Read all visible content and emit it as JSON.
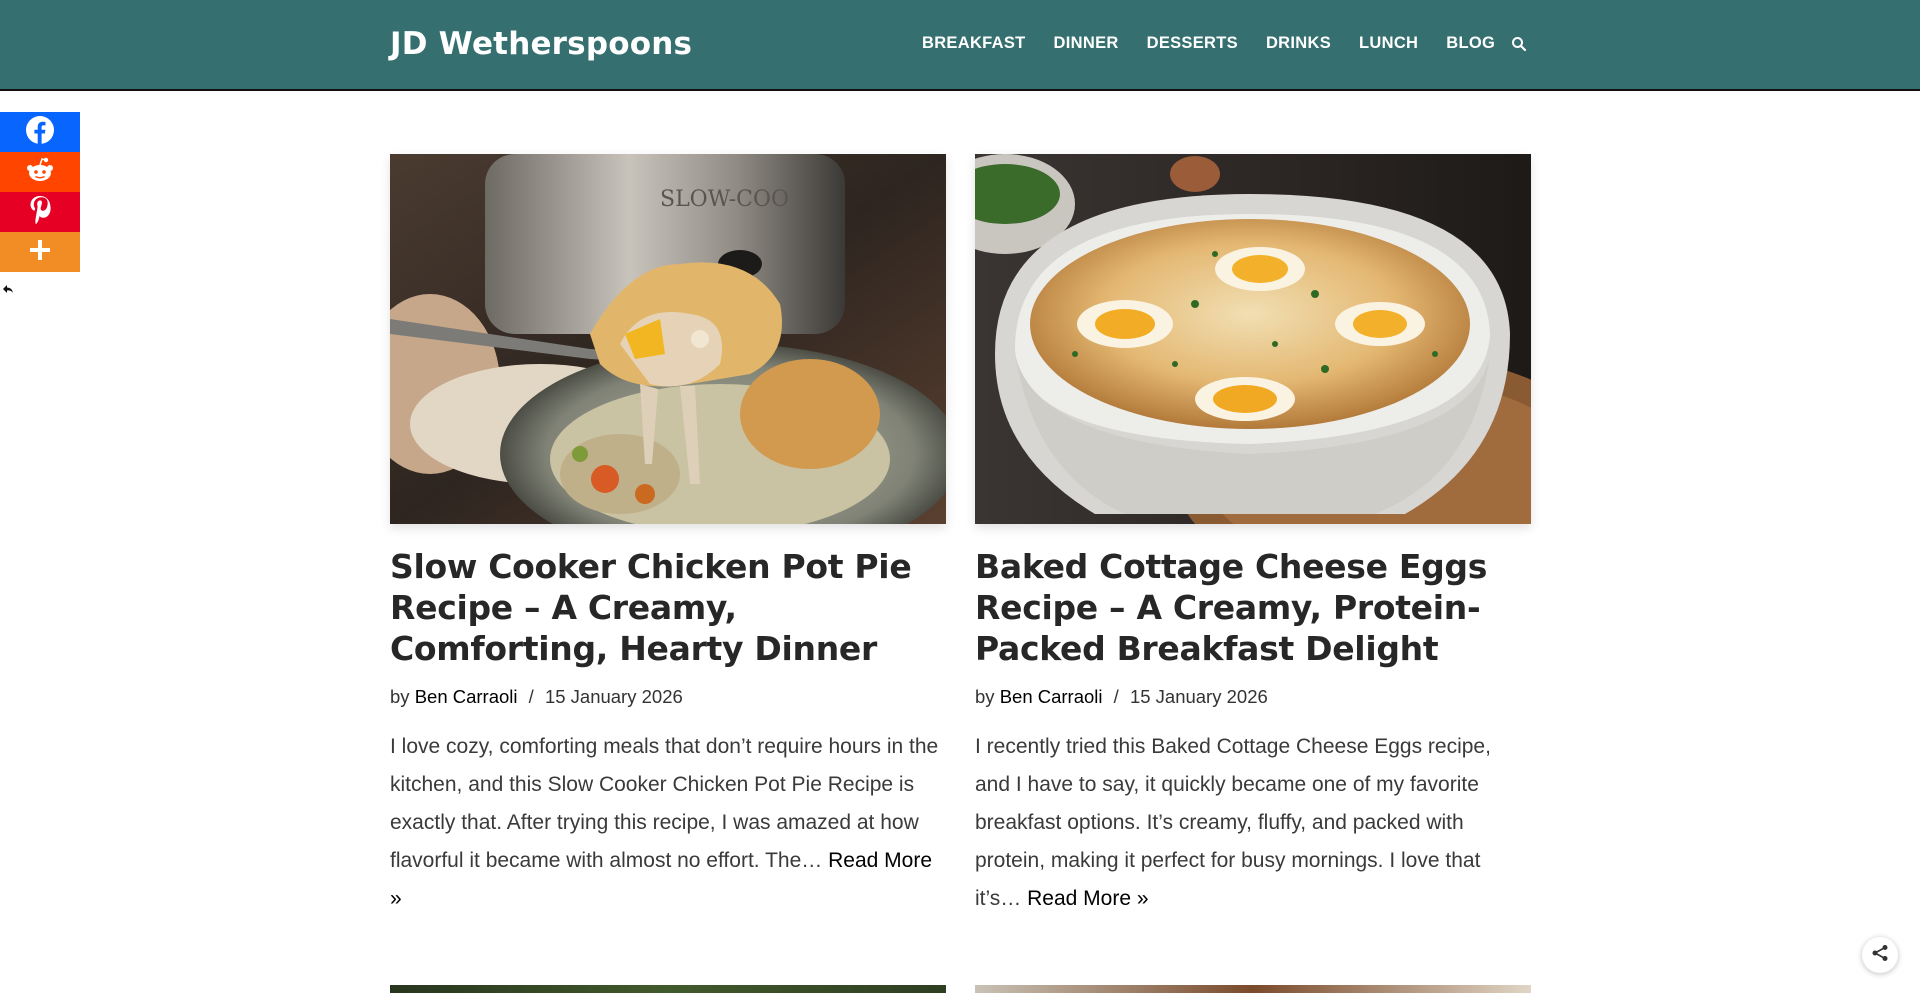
{
  "header": {
    "brand": "JD Wetherspoons",
    "nav": [
      "BREAKFAST",
      "DINNER",
      "DESSERTS",
      "DRINKS",
      "LUNCH",
      "BLOG"
    ],
    "search_icon": "search-icon",
    "bg_color": "#356f6f"
  },
  "share_bar": {
    "items": [
      "facebook-icon",
      "reddit-icon",
      "pinterest-icon",
      "plus-icon"
    ],
    "colors": {
      "facebook": "#0866ff",
      "reddit": "#ff4500",
      "pinterest": "#e60023",
      "more": "#f28c25"
    }
  },
  "posts": [
    {
      "title": "Slow Cooker Chicken Pot Pie Recipe – A Creamy, Comforting, Hearty Dinner",
      "by": "by",
      "author": "Ben Carraoli",
      "date": "15 January 2026",
      "excerpt": "I love cozy, comforting meals that don’t require hours in the kitchen, and this Slow Cooker Chicken Pot Pie Recipe is exactly that. After trying this recipe, I was amazed at how flavorful it became with almost no effort. The…",
      "read_more": "Read More »"
    },
    {
      "title": "Baked Cottage Cheese Eggs Recipe – A Creamy, Protein-Packed Breakfast Delight",
      "by": "by",
      "author": "Ben Carraoli",
      "date": "15 January 2026",
      "excerpt": "I recently tried this Baked Cottage Cheese Eggs recipe, and I have to say, it quickly became one of my favorite breakfast options. It’s creamy, fluffy, and packed with protein, making it perfect for busy mornings. I love that it’s…",
      "read_more": "Read More »"
    }
  ]
}
